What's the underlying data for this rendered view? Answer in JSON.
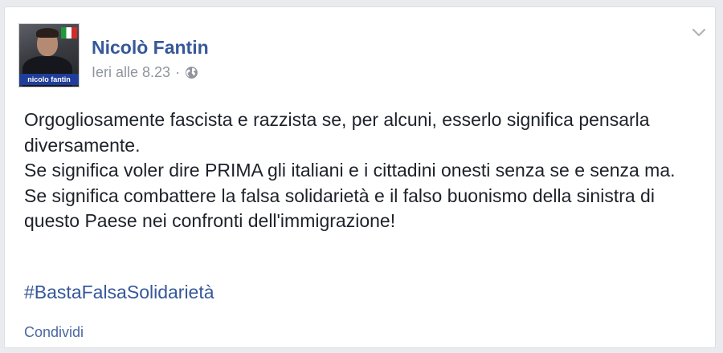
{
  "post": {
    "author": "Nicolò Fantin",
    "avatar_caption": "nicolo fantin",
    "timestamp": "Ieri alle 8.23",
    "separator": "·",
    "privacy_icon": "globe-icon",
    "menu_icon": "chevron-down-icon",
    "paragraphs": [
      "Orgogliosamente fascista e razzista se, per alcuni, esserlo significa pensarla diversamente.",
      "Se significa voler dire PRIMA gli italiani e i cittadini onesti senza se e senza ma.",
      "Se significa combattere la falsa solidarietà e il falso buonismo della sinistra di questo Paese nei confronti dell'immigrazione!"
    ],
    "hashtag": "#BastaFalsaSolidarietà",
    "share_label": "Condividi"
  },
  "colors": {
    "link": "#365899",
    "text": "#1d2129",
    "meta": "#90949c",
    "background": "#e9ebee",
    "card": "#ffffff"
  }
}
